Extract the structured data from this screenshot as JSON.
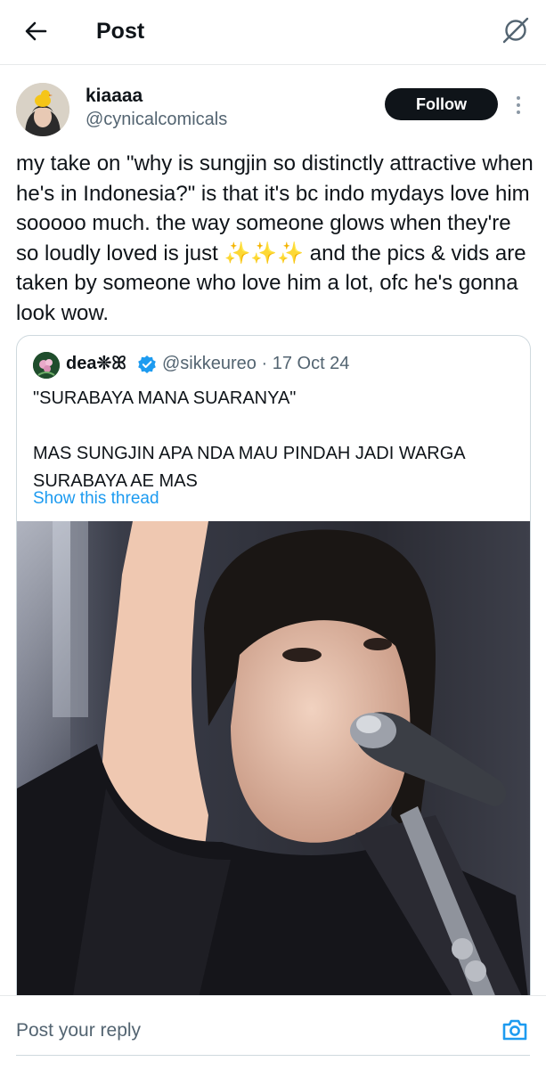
{
  "header": {
    "title": "Post",
    "back_icon": "back-arrow-icon",
    "grok_icon": "grok-icon"
  },
  "post": {
    "display_name": "kiaaaa",
    "handle": "@cynicalcomicals",
    "follow_label": "Follow",
    "text": "my take on \"why is sungjin so distinctly attractive when he's in Indonesia?\" is that it's bc indo mydays love him sooooo much. the way someone glows when they're so loudly loved is just ✨✨✨ and the pics & vids are taken by someone who love him a lot, ofc he's gonna look wow."
  },
  "quoted_post": {
    "display_name": "dea❊ꕤ",
    "handle": "@sikkeureo",
    "separator": "·",
    "date": "17 Oct 24",
    "text": "\"SURABAYA MANA SUARANYA\"\n\nMAS SUNGJIN APA NDA MAU PINDAH JADI WARGA SURABAYA AE MAS",
    "show_thread_label": "Show this thread",
    "verified_icon": "verified-badge-icon"
  },
  "reply": {
    "placeholder": "Post your reply",
    "camera_icon": "camera-icon"
  },
  "colors": {
    "accent": "#1d9bf0",
    "text_primary": "#0f1419",
    "text_secondary": "#536471",
    "follow_button_bg": "#0f1419",
    "border": "#cfd9de"
  }
}
